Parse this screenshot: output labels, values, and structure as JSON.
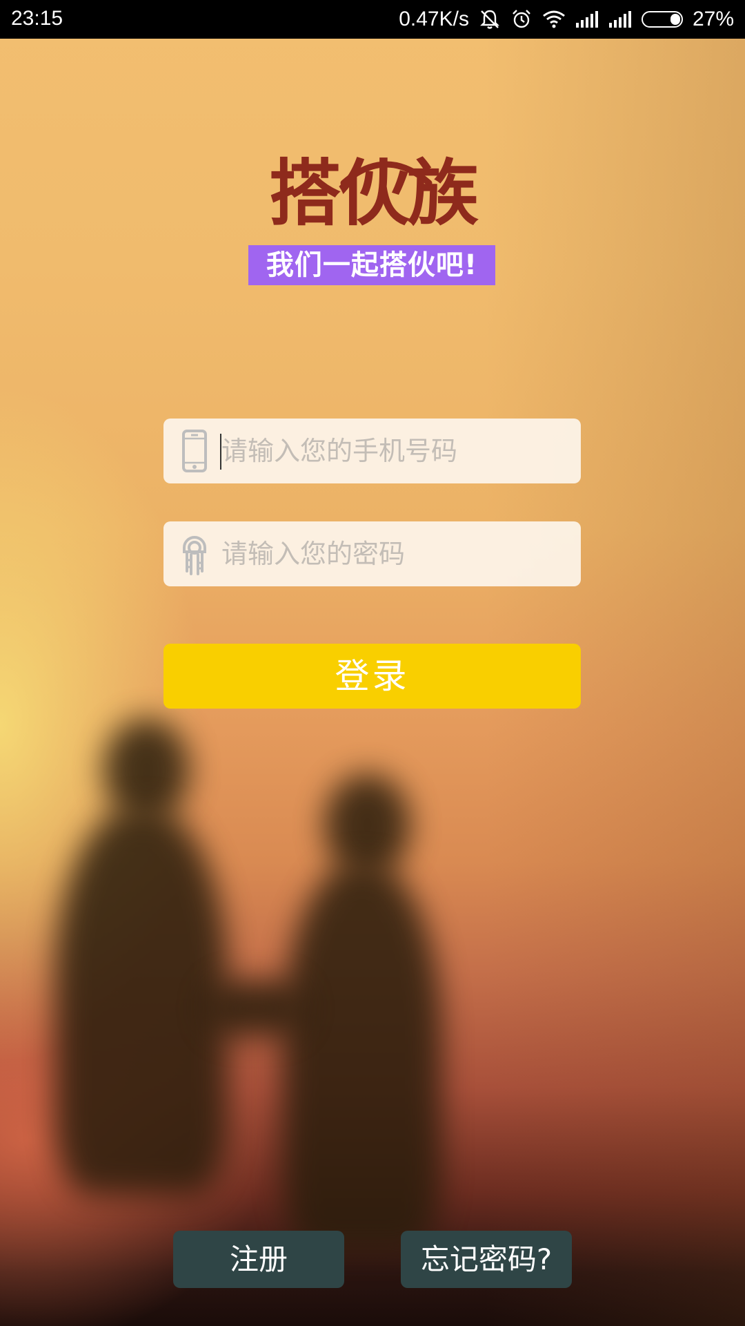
{
  "status_bar": {
    "time": "23:15",
    "network_speed": "0.47K/s",
    "battery": "27%",
    "icons": [
      "mute-icon",
      "alarm-icon",
      "wifi-icon",
      "signal-icon",
      "signal-icon-2",
      "battery-icon"
    ]
  },
  "logo": {
    "title": "搭伙族",
    "slogan": "我们一起搭伙吧!",
    "title_color": "#8e2a1c",
    "slogan_bg": "#a065f0"
  },
  "form": {
    "phone_placeholder": "请输入您的手机号码",
    "password_placeholder": "请输入您的密码",
    "phone_icon": "phone-icon",
    "password_icon": "key-icon"
  },
  "login": {
    "label": "登录",
    "color": "#f9cf00"
  },
  "footer": {
    "register_label": "注册",
    "forgot_label": "忘记密码?",
    "button_color": "#2f4546"
  }
}
